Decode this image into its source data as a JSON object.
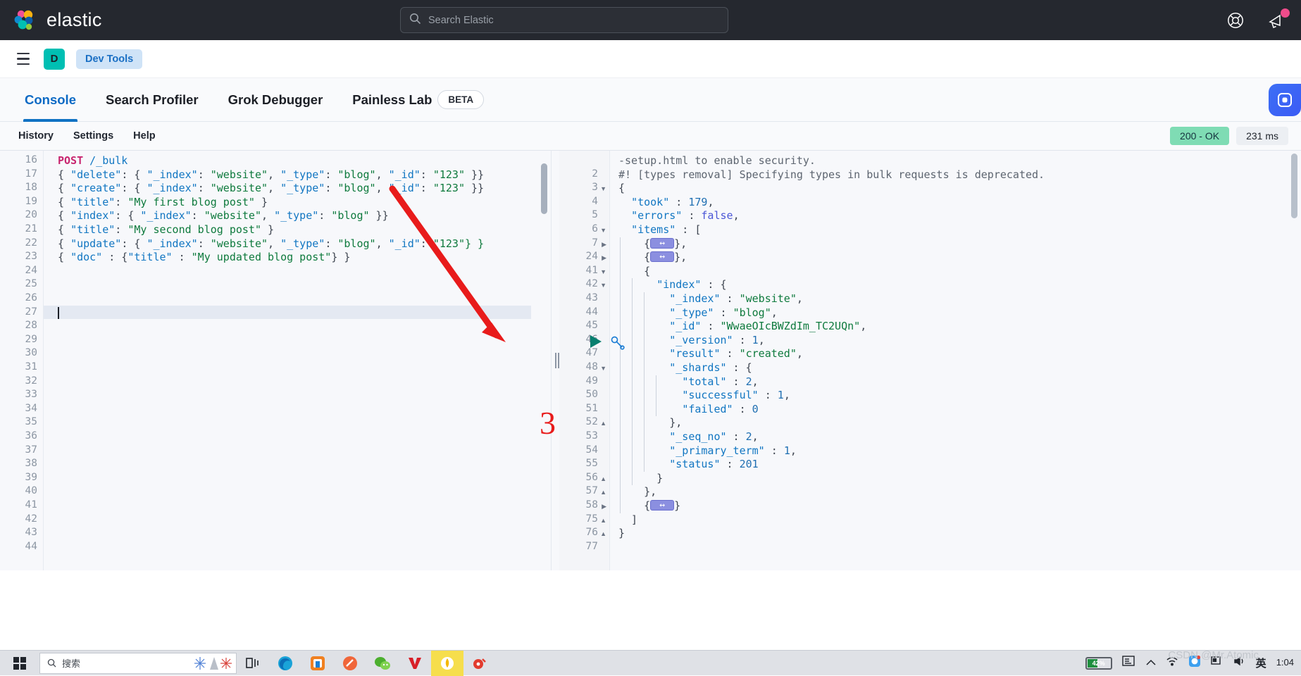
{
  "header": {
    "brand": "elastic",
    "search": {
      "placeholder": "Search Elastic",
      "value": ""
    },
    "icons": [
      {
        "name": "help-lifebuoy-icon",
        "label": "Help"
      },
      {
        "name": "announcement-megaphone-icon",
        "label": "News"
      }
    ]
  },
  "nav": {
    "menu_label": "Menu",
    "avatar_initial": "D",
    "breadcrumb": "Dev Tools"
  },
  "tabs": [
    {
      "label": "Console",
      "active": true
    },
    {
      "label": "Search Profiler",
      "active": false
    },
    {
      "label": "Grok Debugger",
      "active": false
    },
    {
      "label": "Painless Lab",
      "active": false
    }
  ],
  "beta_badge": "BETA",
  "console_toolbar": {
    "items": [
      "History",
      "Settings",
      "Help"
    ],
    "status_code": "200 - OK",
    "duration": "231 ms"
  },
  "editor": {
    "first_line_number": 16,
    "last_line_number": 44,
    "active_line": 27,
    "lines": [
      {
        "n": 16,
        "segments": [
          {
            "t": "POST",
            "c": "t-method"
          },
          {
            "t": " ",
            "c": "t-punc"
          },
          {
            "t": "/_bulk",
            "c": "t-url"
          }
        ]
      },
      {
        "n": 17,
        "segments": [
          {
            "t": "{ ",
            "c": "t-punc"
          },
          {
            "t": "\"delete\"",
            "c": "t-key"
          },
          {
            "t": ": { ",
            "c": "t-punc"
          },
          {
            "t": "\"_index\"",
            "c": "t-key"
          },
          {
            "t": ": ",
            "c": "t-punc"
          },
          {
            "t": "\"website\"",
            "c": "t-str"
          },
          {
            "t": ", ",
            "c": "t-punc"
          },
          {
            "t": "\"_type\"",
            "c": "t-key"
          },
          {
            "t": ": ",
            "c": "t-punc"
          },
          {
            "t": "\"blog\"",
            "c": "t-str"
          },
          {
            "t": ", ",
            "c": "t-punc"
          },
          {
            "t": "\"_id\"",
            "c": "t-key"
          },
          {
            "t": ": ",
            "c": "t-punc"
          },
          {
            "t": "\"123\"",
            "c": "t-str"
          },
          {
            "t": " }}",
            "c": "t-punc"
          }
        ]
      },
      {
        "n": 18,
        "segments": [
          {
            "t": "{ ",
            "c": "t-punc"
          },
          {
            "t": "\"create\"",
            "c": "t-key"
          },
          {
            "t": ": { ",
            "c": "t-punc"
          },
          {
            "t": "\"_index\"",
            "c": "t-key"
          },
          {
            "t": ": ",
            "c": "t-punc"
          },
          {
            "t": "\"website\"",
            "c": "t-str"
          },
          {
            "t": ", ",
            "c": "t-punc"
          },
          {
            "t": "\"_type\"",
            "c": "t-key"
          },
          {
            "t": ": ",
            "c": "t-punc"
          },
          {
            "t": "\"blog\"",
            "c": "t-str"
          },
          {
            "t": ", ",
            "c": "t-punc"
          },
          {
            "t": "\"_id\"",
            "c": "t-key"
          },
          {
            "t": ": ",
            "c": "t-punc"
          },
          {
            "t": "\"123\"",
            "c": "t-str"
          },
          {
            "t": " }}",
            "c": "t-punc"
          }
        ]
      },
      {
        "n": 19,
        "segments": [
          {
            "t": "{ ",
            "c": "t-punc"
          },
          {
            "t": "\"title\"",
            "c": "t-key"
          },
          {
            "t": ": ",
            "c": "t-punc"
          },
          {
            "t": "\"My first blog post\"",
            "c": "t-str"
          },
          {
            "t": " }",
            "c": "t-punc"
          }
        ]
      },
      {
        "n": 20,
        "segments": [
          {
            "t": "{ ",
            "c": "t-punc"
          },
          {
            "t": "\"index\"",
            "c": "t-key"
          },
          {
            "t": ": { ",
            "c": "t-punc"
          },
          {
            "t": "\"_index\"",
            "c": "t-key"
          },
          {
            "t": ": ",
            "c": "t-punc"
          },
          {
            "t": "\"website\"",
            "c": "t-str"
          },
          {
            "t": ", ",
            "c": "t-punc"
          },
          {
            "t": "\"_type\"",
            "c": "t-key"
          },
          {
            "t": ": ",
            "c": "t-punc"
          },
          {
            "t": "\"blog\"",
            "c": "t-str"
          },
          {
            "t": " }}",
            "c": "t-punc"
          }
        ]
      },
      {
        "n": 21,
        "segments": [
          {
            "t": "{ ",
            "c": "t-punc"
          },
          {
            "t": "\"title\"",
            "c": "t-key"
          },
          {
            "t": ": ",
            "c": "t-punc"
          },
          {
            "t": "\"My second blog post\"",
            "c": "t-str"
          },
          {
            "t": " }",
            "c": "t-punc"
          }
        ]
      },
      {
        "n": 22,
        "segments": [
          {
            "t": "{ ",
            "c": "t-punc"
          },
          {
            "t": "\"update\"",
            "c": "t-key"
          },
          {
            "t": ": { ",
            "c": "t-punc"
          },
          {
            "t": "\"_index\"",
            "c": "t-key"
          },
          {
            "t": ": ",
            "c": "t-punc"
          },
          {
            "t": "\"website\"",
            "c": "t-str"
          },
          {
            "t": ", ",
            "c": "t-punc"
          },
          {
            "t": "\"_type\"",
            "c": "t-key"
          },
          {
            "t": ": ",
            "c": "t-punc"
          },
          {
            "t": "\"blog\"",
            "c": "t-str"
          },
          {
            "t": ", ",
            "c": "t-punc"
          },
          {
            "t": "\"_id\"",
            "c": "t-key"
          },
          {
            "t": ": ",
            "c": "t-punc"
          },
          {
            "t": "\"123\"} }",
            "c": "t-str"
          }
        ]
      },
      {
        "n": 23,
        "segments": [
          {
            "t": "{ ",
            "c": "t-punc"
          },
          {
            "t": "\"doc\"",
            "c": "t-key"
          },
          {
            "t": " : {",
            "c": "t-punc"
          },
          {
            "t": "\"title\"",
            "c": "t-key"
          },
          {
            "t": " : ",
            "c": "t-punc"
          },
          {
            "t": "\"My updated blog post\"",
            "c": "t-str"
          },
          {
            "t": "} }",
            "c": "t-punc"
          }
        ]
      },
      {
        "n": 24,
        "segments": []
      },
      {
        "n": 25,
        "segments": []
      },
      {
        "n": 26,
        "segments": []
      },
      {
        "n": 27,
        "segments": []
      },
      {
        "n": 28,
        "segments": []
      },
      {
        "n": 29,
        "segments": []
      },
      {
        "n": 30,
        "segments": []
      },
      {
        "n": 31,
        "segments": []
      },
      {
        "n": 32,
        "segments": []
      },
      {
        "n": 33,
        "segments": []
      },
      {
        "n": 34,
        "segments": []
      },
      {
        "n": 35,
        "segments": []
      },
      {
        "n": 36,
        "segments": []
      },
      {
        "n": 37,
        "segments": []
      },
      {
        "n": 38,
        "segments": []
      },
      {
        "n": 39,
        "segments": []
      },
      {
        "n": 40,
        "segments": []
      },
      {
        "n": 41,
        "segments": []
      },
      {
        "n": 42,
        "segments": []
      },
      {
        "n": 43,
        "segments": []
      },
      {
        "n": 44,
        "segments": []
      }
    ],
    "run_button": "play-button",
    "wrench_button": "wrench-button"
  },
  "response": {
    "lines": [
      {
        "n": "",
        "fold": "",
        "indent": 0,
        "segments": [
          {
            "t": "-setup.html to enable security.",
            "c": "t-comment"
          }
        ]
      },
      {
        "n": "2",
        "fold": "",
        "indent": 0,
        "segments": [
          {
            "t": "#! [types removal] Specifying types in bulk requests is deprecated.",
            "c": "t-comment"
          }
        ]
      },
      {
        "n": "3",
        "fold": "open",
        "indent": 0,
        "segments": [
          {
            "t": "{",
            "c": "t-punc"
          }
        ]
      },
      {
        "n": "4",
        "fold": "",
        "indent": 0,
        "segments": [
          {
            "t": "  ",
            "c": "t-punc"
          },
          {
            "t": "\"took\"",
            "c": "t-key"
          },
          {
            "t": " : ",
            "c": "t-punc"
          },
          {
            "t": "179",
            "c": "t-num"
          },
          {
            "t": ",",
            "c": "t-punc"
          }
        ]
      },
      {
        "n": "5",
        "fold": "",
        "indent": 0,
        "segments": [
          {
            "t": "  ",
            "c": "t-punc"
          },
          {
            "t": "\"errors\"",
            "c": "t-key"
          },
          {
            "t": " : ",
            "c": "t-punc"
          },
          {
            "t": "false",
            "c": "t-bool"
          },
          {
            "t": ",",
            "c": "t-punc"
          }
        ]
      },
      {
        "n": "6",
        "fold": "open",
        "indent": 0,
        "segments": [
          {
            "t": "  ",
            "c": "t-punc"
          },
          {
            "t": "\"items\"",
            "c": "t-key"
          },
          {
            "t": " : [",
            "c": "t-punc"
          }
        ]
      },
      {
        "n": "7",
        "fold": "closed",
        "indent": 1,
        "segments": [
          {
            "t": "    {",
            "c": "t-punc"
          },
          {
            "t": "@FOLD@",
            "c": "t-punc"
          },
          {
            "t": "},",
            "c": "t-punc"
          }
        ]
      },
      {
        "n": "24",
        "fold": "closed",
        "indent": 1,
        "segments": [
          {
            "t": "    {",
            "c": "t-punc"
          },
          {
            "t": "@FOLD@",
            "c": "t-punc"
          },
          {
            "t": "},",
            "c": "t-punc"
          }
        ]
      },
      {
        "n": "41",
        "fold": "open",
        "indent": 1,
        "segments": [
          {
            "t": "    {",
            "c": "t-punc"
          }
        ]
      },
      {
        "n": "42",
        "fold": "open",
        "indent": 2,
        "segments": [
          {
            "t": "      ",
            "c": "t-punc"
          },
          {
            "t": "\"index\"",
            "c": "t-key"
          },
          {
            "t": " : {",
            "c": "t-punc"
          }
        ]
      },
      {
        "n": "43",
        "fold": "",
        "indent": 3,
        "segments": [
          {
            "t": "        ",
            "c": "t-punc"
          },
          {
            "t": "\"_index\"",
            "c": "t-key"
          },
          {
            "t": " : ",
            "c": "t-punc"
          },
          {
            "t": "\"website\"",
            "c": "t-str"
          },
          {
            "t": ",",
            "c": "t-punc"
          }
        ]
      },
      {
        "n": "44",
        "fold": "",
        "indent": 3,
        "segments": [
          {
            "t": "        ",
            "c": "t-punc"
          },
          {
            "t": "\"_type\"",
            "c": "t-key"
          },
          {
            "t": " : ",
            "c": "t-punc"
          },
          {
            "t": "\"blog\"",
            "c": "t-str"
          },
          {
            "t": ",",
            "c": "t-punc"
          }
        ]
      },
      {
        "n": "45",
        "fold": "",
        "indent": 3,
        "segments": [
          {
            "t": "        ",
            "c": "t-punc"
          },
          {
            "t": "\"_id\"",
            "c": "t-key"
          },
          {
            "t": " : ",
            "c": "t-punc"
          },
          {
            "t": "\"WwaeOIcBWZdIm_TC2UQn\"",
            "c": "t-str"
          },
          {
            "t": ",",
            "c": "t-punc"
          }
        ]
      },
      {
        "n": "46",
        "fold": "",
        "indent": 3,
        "segments": [
          {
            "t": "        ",
            "c": "t-punc"
          },
          {
            "t": "\"_version\"",
            "c": "t-key"
          },
          {
            "t": " : ",
            "c": "t-punc"
          },
          {
            "t": "1",
            "c": "t-num"
          },
          {
            "t": ",",
            "c": "t-punc"
          }
        ]
      },
      {
        "n": "47",
        "fold": "",
        "indent": 3,
        "segments": [
          {
            "t": "        ",
            "c": "t-punc"
          },
          {
            "t": "\"result\"",
            "c": "t-key"
          },
          {
            "t": " : ",
            "c": "t-punc"
          },
          {
            "t": "\"created\"",
            "c": "t-str"
          },
          {
            "t": ",",
            "c": "t-punc"
          }
        ]
      },
      {
        "n": "48",
        "fold": "open",
        "indent": 3,
        "segments": [
          {
            "t": "        ",
            "c": "t-punc"
          },
          {
            "t": "\"_shards\"",
            "c": "t-key"
          },
          {
            "t": " : {",
            "c": "t-punc"
          }
        ]
      },
      {
        "n": "49",
        "fold": "",
        "indent": 4,
        "segments": [
          {
            "t": "          ",
            "c": "t-punc"
          },
          {
            "t": "\"total\"",
            "c": "t-key"
          },
          {
            "t": " : ",
            "c": "t-punc"
          },
          {
            "t": "2",
            "c": "t-num"
          },
          {
            "t": ",",
            "c": "t-punc"
          }
        ]
      },
      {
        "n": "50",
        "fold": "",
        "indent": 4,
        "segments": [
          {
            "t": "          ",
            "c": "t-punc"
          },
          {
            "t": "\"successful\"",
            "c": "t-key"
          },
          {
            "t": " : ",
            "c": "t-punc"
          },
          {
            "t": "1",
            "c": "t-num"
          },
          {
            "t": ",",
            "c": "t-punc"
          }
        ]
      },
      {
        "n": "51",
        "fold": "",
        "indent": 4,
        "segments": [
          {
            "t": "          ",
            "c": "t-punc"
          },
          {
            "t": "\"failed\"",
            "c": "t-key"
          },
          {
            "t": " : ",
            "c": "t-punc"
          },
          {
            "t": "0",
            "c": "t-num"
          }
        ]
      },
      {
        "n": "52",
        "fold": "up",
        "indent": 3,
        "segments": [
          {
            "t": "        },",
            "c": "t-punc"
          }
        ]
      },
      {
        "n": "53",
        "fold": "",
        "indent": 3,
        "segments": [
          {
            "t": "        ",
            "c": "t-punc"
          },
          {
            "t": "\"_seq_no\"",
            "c": "t-key"
          },
          {
            "t": " : ",
            "c": "t-punc"
          },
          {
            "t": "2",
            "c": "t-num"
          },
          {
            "t": ",",
            "c": "t-punc"
          }
        ]
      },
      {
        "n": "54",
        "fold": "",
        "indent": 3,
        "segments": [
          {
            "t": "        ",
            "c": "t-punc"
          },
          {
            "t": "\"_primary_term\"",
            "c": "t-key"
          },
          {
            "t": " : ",
            "c": "t-punc"
          },
          {
            "t": "1",
            "c": "t-num"
          },
          {
            "t": ",",
            "c": "t-punc"
          }
        ]
      },
      {
        "n": "55",
        "fold": "",
        "indent": 3,
        "segments": [
          {
            "t": "        ",
            "c": "t-punc"
          },
          {
            "t": "\"status\"",
            "c": "t-key"
          },
          {
            "t": " : ",
            "c": "t-punc"
          },
          {
            "t": "201",
            "c": "t-num"
          }
        ]
      },
      {
        "n": "56",
        "fold": "up",
        "indent": 2,
        "segments": [
          {
            "t": "      }",
            "c": "t-punc"
          }
        ]
      },
      {
        "n": "57",
        "fold": "up",
        "indent": 1,
        "segments": [
          {
            "t": "    },",
            "c": "t-punc"
          }
        ]
      },
      {
        "n": "58",
        "fold": "closed",
        "indent": 1,
        "segments": [
          {
            "t": "    {",
            "c": "t-punc"
          },
          {
            "t": "@FOLD@",
            "c": "t-punc"
          },
          {
            "t": "}",
            "c": "t-punc"
          }
        ]
      },
      {
        "n": "75",
        "fold": "up",
        "indent": 0,
        "segments": [
          {
            "t": "  ]",
            "c": "t-punc"
          }
        ]
      },
      {
        "n": "76",
        "fold": "up",
        "indent": 0,
        "segments": [
          {
            "t": "}",
            "c": "t-punc"
          }
        ]
      },
      {
        "n": "77",
        "fold": "",
        "indent": 0,
        "segments": []
      }
    ]
  },
  "annotation": {
    "number": "3",
    "color": "#e81b1b"
  },
  "taskbar": {
    "search_placeholder": "搜索",
    "clock_time": "1:04",
    "battery_pct": "42%",
    "watermark": "CSDN @Mr.Atomic",
    "icons": [
      "start-windows-icon",
      "task-view-icon",
      "edge-browser-icon",
      "store-icon",
      "paint-icon",
      "wechat-icon",
      "youku-icon",
      "notes-icon",
      "music-icon"
    ],
    "tray_icons": [
      "battery-icon",
      "news-icon",
      "chevron-up-icon",
      "network-icon",
      "security-icon",
      "display-icon",
      "volume-icon",
      "ime-icon"
    ]
  }
}
